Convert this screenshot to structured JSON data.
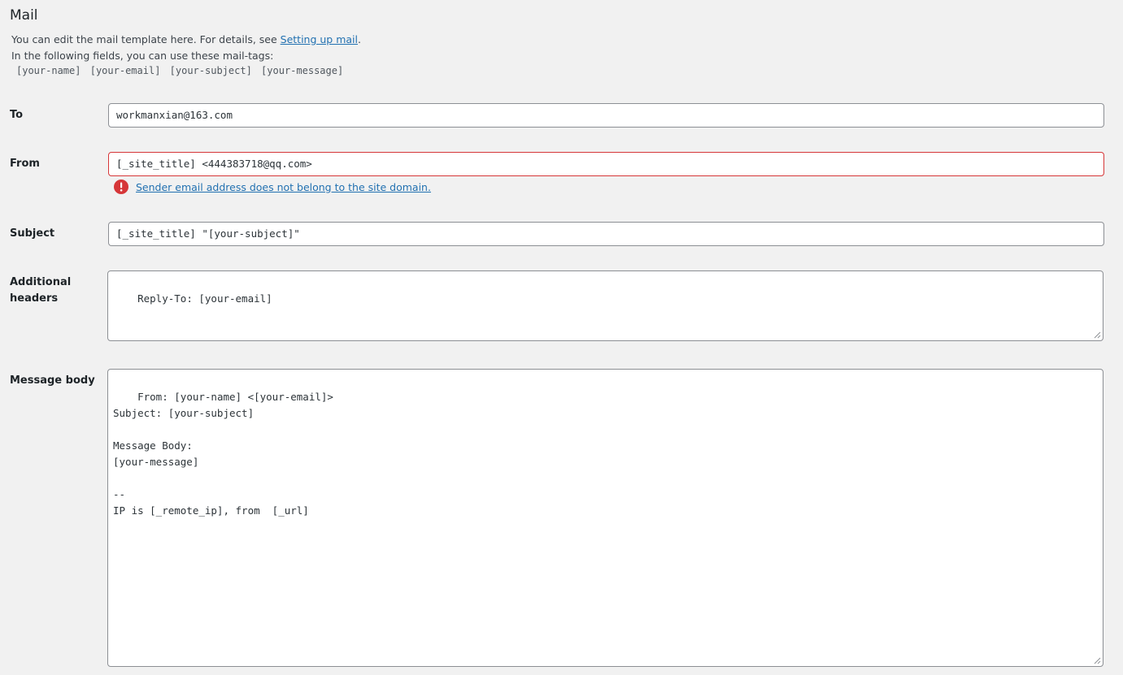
{
  "section": {
    "title": "Mail",
    "desc_line1_prefix": "You can edit the mail template here. For details, see ",
    "desc_line1_link": "Setting up mail",
    "desc_line1_suffix": ".",
    "desc_line2": "In the following fields, you can use these mail-tags:",
    "mail_tags": [
      "[your-name]",
      "[your-email]",
      "[your-subject]",
      "[your-message]"
    ]
  },
  "fields": {
    "to": {
      "label": "To",
      "value": "workmanxian@163.com"
    },
    "from": {
      "label": "From",
      "value": "[_site_title] <444383718@qq.com>",
      "error": "Sender email address does not belong to the site domain."
    },
    "subject": {
      "label": "Subject",
      "value": "[_site_title] \"[your-subject]\""
    },
    "additional_headers": {
      "label_line1": "Additional",
      "label_line2": "headers",
      "value": "Reply-To: [your-email]"
    },
    "message_body": {
      "label": "Message body",
      "value": "From: [your-name] <[your-email]>\nSubject: [your-subject]\n\nMessage Body:\n[your-message]\n\n-- \nIP is [_remote_ip], from  [_url]"
    }
  },
  "colors": {
    "error": "#d63638",
    "link": "#2271b1",
    "background": "#f1f1f1"
  }
}
